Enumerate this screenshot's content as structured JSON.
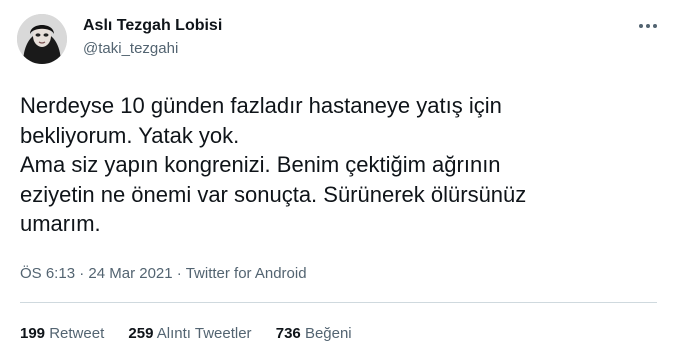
{
  "author": {
    "display_name": "Aslı Tezgah Lobisi",
    "handle": "@taki_tezgahi",
    "avatar_icon": "profile-photo"
  },
  "more_icon": "ellipsis-icon",
  "tweet": {
    "lines": [
      "Nerdeyse 10 günden fazladır hastaneye yatış için",
      "bekliyorum. Yatak yok.",
      "Ama siz yapın kongrenizi. Benim çektiğim ağrının",
      "eziyetin ne önemi var sonuçta. Sürünerek ölürsünüz",
      "umarım."
    ]
  },
  "meta": {
    "time": "ÖS 6:13",
    "separator": " · ",
    "date": "24 Mar 2021",
    "source": "Twitter for Android"
  },
  "stats": {
    "retweets": {
      "count": "199",
      "label": "Retweet"
    },
    "quotes": {
      "count": "259",
      "label": "Alıntı Tweetler"
    },
    "likes": {
      "count": "736",
      "label": "Beğeni"
    }
  },
  "colors": {
    "text": "#0f1419",
    "secondary": "#536471",
    "divider": "#cfd9de"
  }
}
